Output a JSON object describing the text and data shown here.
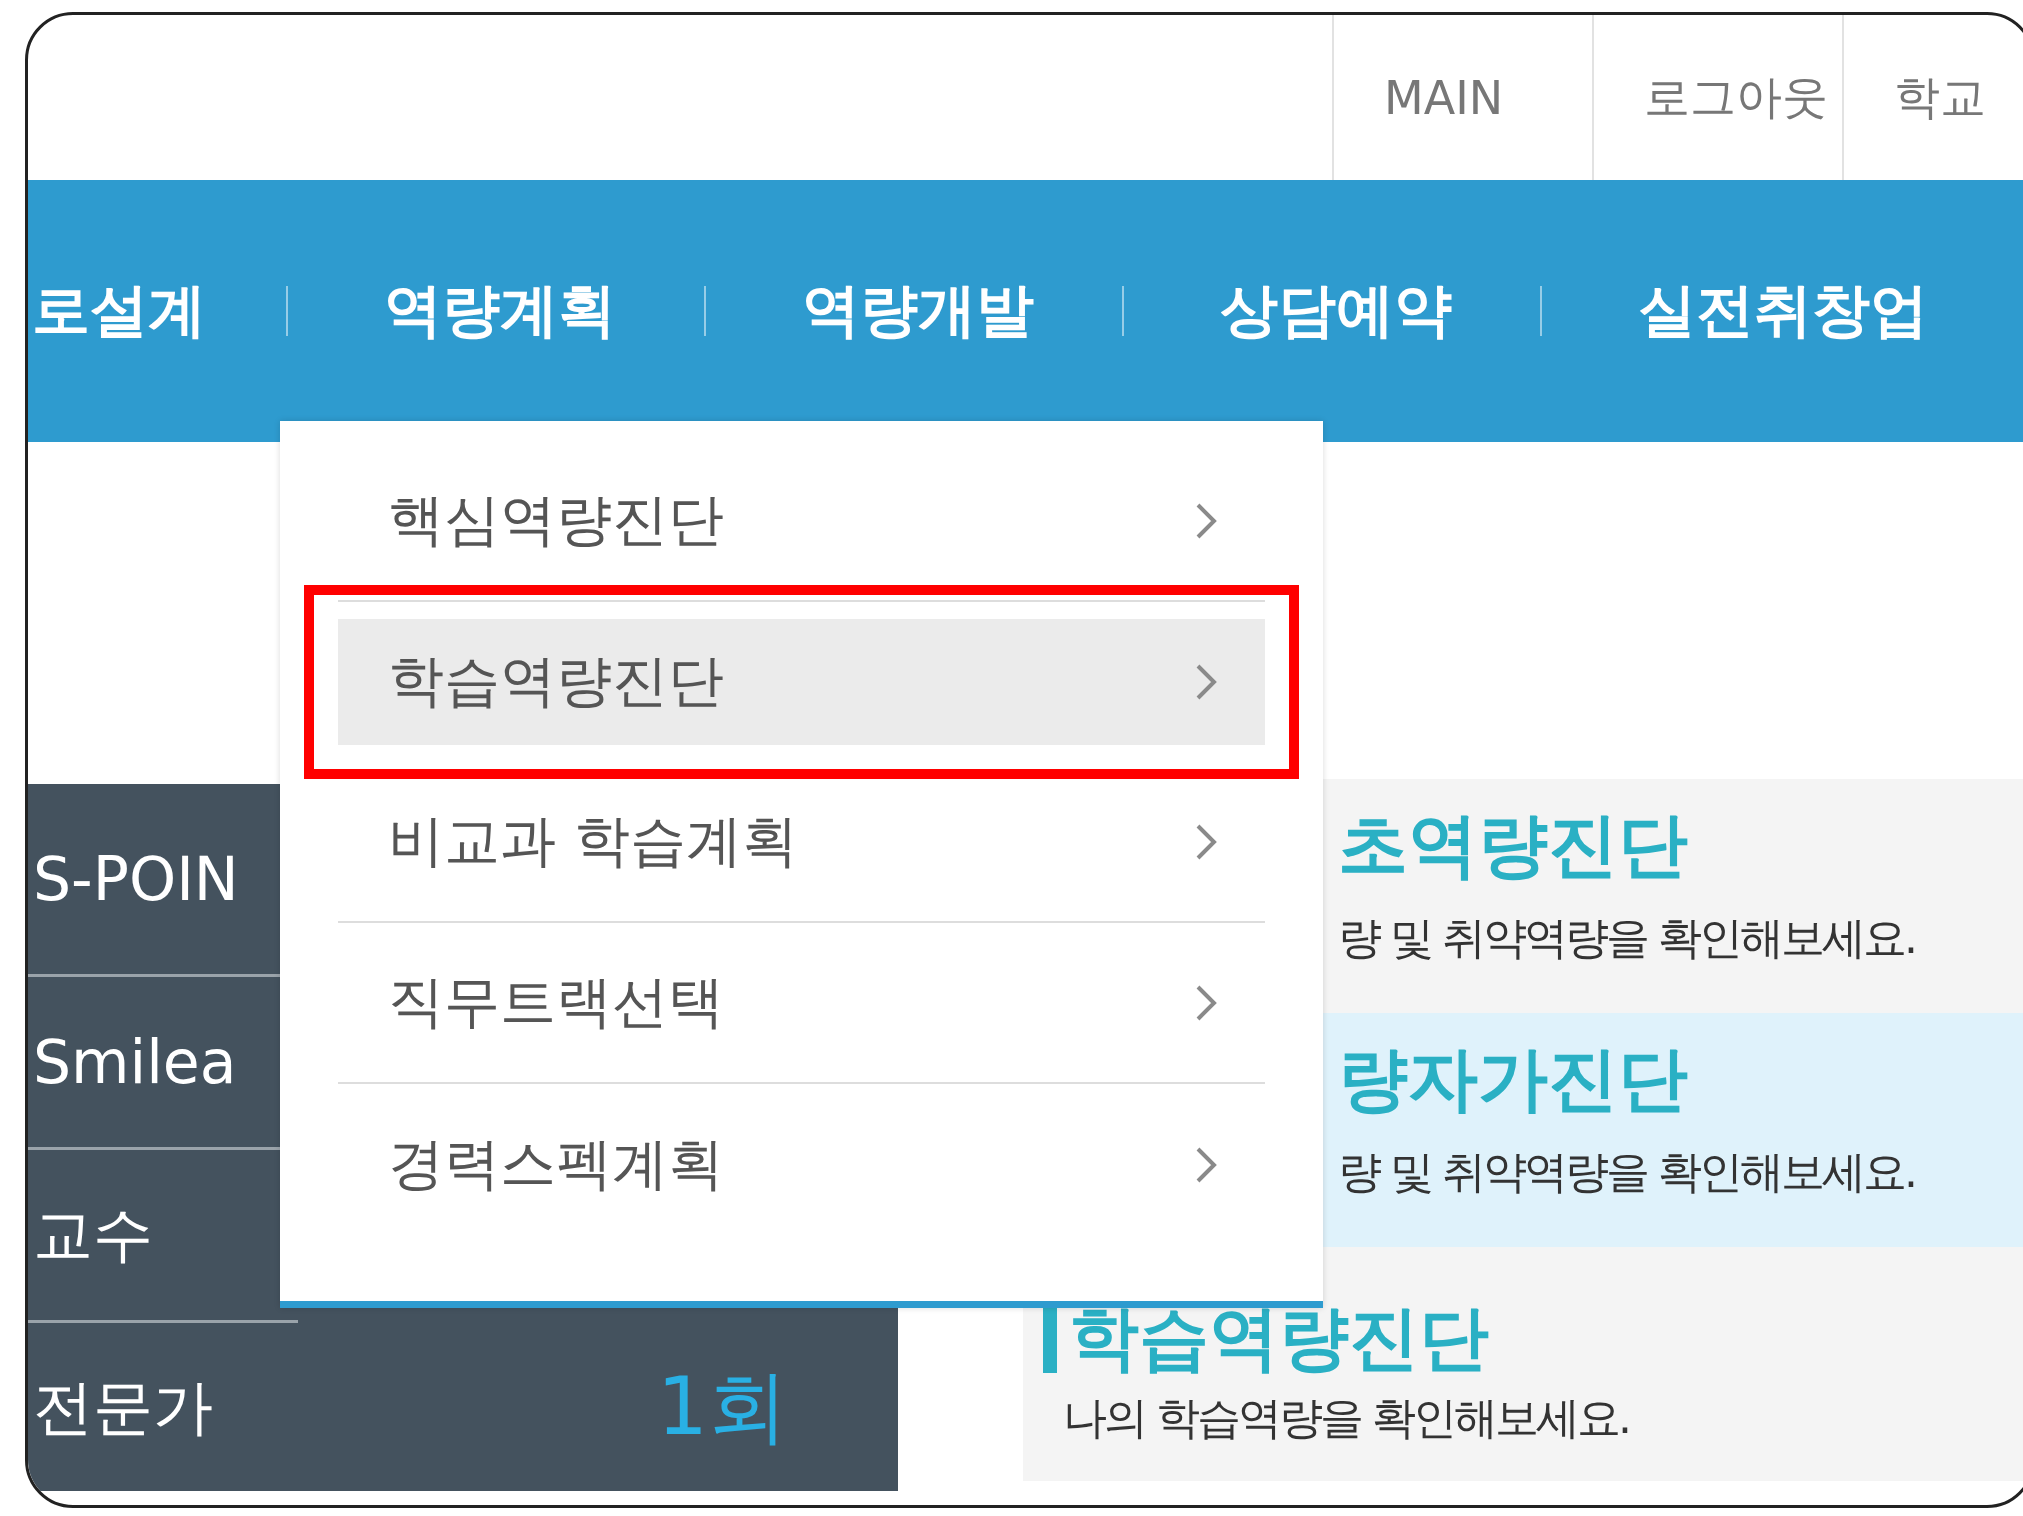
{
  "util_links": [
    {
      "label": "MAIN"
    },
    {
      "label": "로그아웃"
    },
    {
      "label": "학교"
    }
  ],
  "nav": [
    {
      "label": "로설계"
    },
    {
      "label": "역량계획"
    },
    {
      "label": "역량개발"
    },
    {
      "label": "상담예약"
    },
    {
      "label": "실전취창업"
    }
  ],
  "dropdown": [
    {
      "label": "핵심역량진단",
      "selected": false,
      "outlined": false
    },
    {
      "label": "학습역량진단",
      "selected": true,
      "outlined": true
    },
    {
      "label": "비교과 학습계획",
      "selected": false,
      "outlined": false
    },
    {
      "label": "직무트랙선택",
      "selected": false,
      "outlined": false
    },
    {
      "label": "경력스펙계획",
      "selected": false,
      "outlined": false
    }
  ],
  "stats": [
    {
      "label": "S-POIN"
    },
    {
      "label": "Smilea"
    },
    {
      "label": "교수"
    },
    {
      "label": "전문가",
      "value": "1회"
    }
  ],
  "cards": [
    {
      "title": "초역량진단",
      "description": "량 및 취약역량을 확인해보세요.",
      "highlighted": false
    },
    {
      "title": "량자가진단",
      "description": "량 및 취약역량을 확인해보세요.",
      "highlighted": true
    },
    {
      "title": "학습역량진단",
      "description": "나의 학습역량을 확인해보세요.",
      "highlighted": false
    }
  ]
}
